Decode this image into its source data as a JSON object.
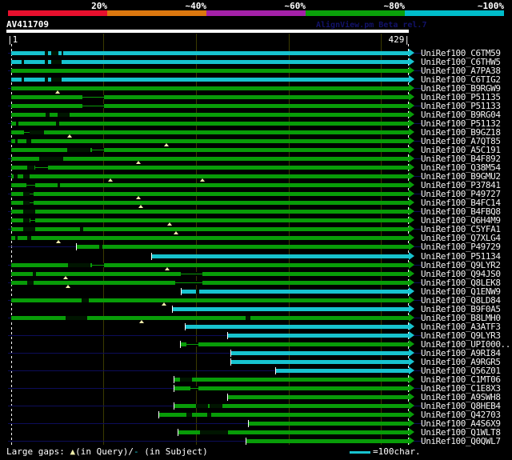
{
  "header": {
    "query_id": "AV411709",
    "credit": "AlignView.pm Beta rel.7"
  },
  "scale_bar": {
    "segments": [
      {
        "label": "20%",
        "color": "#e8102e"
      },
      {
        "label": "~40%",
        "color": "#dc780f"
      },
      {
        "label": "~60%",
        "color": "#a421a8"
      },
      {
        "label": "~80%",
        "color": "#0aa00a"
      },
      {
        "label": "~100%",
        "color": "#00bcca"
      }
    ]
  },
  "ruler": {
    "start_label": "|1",
    "end_label": "429|",
    "min": 1,
    "max": 429,
    "gridline_interval": 100
  },
  "legend": {
    "gaps_prefix": "Large gaps: ",
    "query_symbol": "▲",
    "query_text": "(in Query)/",
    "subject_symbol": "-",
    "subject_text": " (in Subject)",
    "scale_text": "=100char."
  },
  "colors": {
    "background": "#000000",
    "bar_green": "#089c08",
    "bar_cyan": "#17c3cf",
    "guide_navy": "#0d0d5a",
    "gridline_olive": "#3a3a00",
    "gap_dark": "#001500",
    "triangle_yellow": "#efedaa",
    "text_white": "#ffffff",
    "credit_navy": "#12126a"
  },
  "chart_data": {
    "type": "alignment-overview",
    "query": {
      "id": "AV411709",
      "length": 429
    },
    "x_range": [
      1,
      429
    ],
    "gridlines_at": [
      100,
      200,
      300,
      400
    ],
    "hits": [
      {
        "label": "UniRef100_C6TM59",
        "color": "cyan",
        "start": 1,
        "end": 429,
        "dashes": [
          [
            37,
            41
          ],
          [
            44,
            52
          ],
          [
            55,
            57
          ]
        ],
        "thins": [],
        "tris": [],
        "guide": true
      },
      {
        "label": "UniRef100_C6THW5",
        "color": "cyan",
        "start": 1,
        "end": 429,
        "dashes": [
          [
            12,
            15
          ],
          [
            37,
            41
          ],
          [
            44,
            55
          ]
        ],
        "thins": [],
        "tris": [],
        "guide": false
      },
      {
        "label": "UniRef100_A7PA38",
        "color": "green",
        "start": 1,
        "end": 429,
        "dashes": [],
        "thins": [],
        "tris": [],
        "guide": true
      },
      {
        "label": "UniRef100_C6TIG2",
        "color": "cyan",
        "start": 1,
        "end": 429,
        "dashes": [
          [
            12,
            15
          ],
          [
            37,
            41
          ],
          [
            44,
            55
          ]
        ],
        "thins": [],
        "tris": [],
        "guide": false
      },
      {
        "label": "UniRef100_B9RGW9",
        "color": "green",
        "start": 1,
        "end": 429,
        "dashes": [],
        "thins": [],
        "tris": [
          51
        ],
        "guide": true
      },
      {
        "label": "UniRef100_P51135",
        "color": "green",
        "start": 1,
        "end": 429,
        "dashes": [],
        "thins": [
          [
            78,
            101
          ]
        ],
        "tris": [],
        "guide": false
      },
      {
        "label": "UniRef100_P51133",
        "color": "green",
        "start": 1,
        "end": 429,
        "dashes": [],
        "thins": [
          [
            78,
            101
          ]
        ],
        "tris": [],
        "guide": true
      },
      {
        "label": "UniRef100_B9RG04",
        "color": "green",
        "start": 1,
        "end": 429,
        "dashes": [
          [
            38,
            42
          ],
          [
            51,
            64
          ]
        ],
        "thins": [],
        "tris": [],
        "guide": false
      },
      {
        "label": "UniRef100_P51132",
        "color": "green",
        "start": 1,
        "end": 429,
        "dashes": [
          [
            6,
            9
          ],
          [
            49,
            53
          ]
        ],
        "thins": [],
        "tris": [],
        "guide": true
      },
      {
        "label": "UniRef100_B9GZ18",
        "color": "green",
        "start": 1,
        "end": 429,
        "dashes": [
          [
            21,
            36
          ]
        ],
        "thins": [
          [
            15,
            21
          ]
        ],
        "tris": [
          64
        ],
        "guide": false
      },
      {
        "label": "UniRef100_A7QT85",
        "color": "green",
        "start": 1,
        "end": 429,
        "dashes": [
          [
            5,
            8
          ],
          [
            17,
            23
          ]
        ],
        "thins": [],
        "tris": [
          168
        ],
        "guide": true
      },
      {
        "label": "UniRef100_A5C191",
        "color": "green",
        "start": 1,
        "end": 429,
        "dashes": [
          [
            61,
            86
          ]
        ],
        "thins": [
          [
            88,
            101
          ]
        ],
        "tris": [],
        "guide": false
      },
      {
        "label": "UniRef100_B4F892",
        "color": "green",
        "start": 1,
        "end": 429,
        "dashes": [
          [
            31,
            57
          ]
        ],
        "thins": [],
        "tris": [
          138
        ],
        "guide": true
      },
      {
        "label": "UniRef100_Q38M54",
        "color": "green",
        "start": 1,
        "end": 429,
        "dashes": [
          [
            18,
            26
          ]
        ],
        "thins": [
          [
            27,
            41
          ]
        ],
        "tris": [],
        "guide": false
      },
      {
        "label": "UniRef100_B9GMU2",
        "color": "green",
        "start": 1,
        "end": 429,
        "dashes": [
          [
            4,
            8
          ],
          [
            14,
            21
          ]
        ],
        "thins": [],
        "tris": [
          108,
          207
        ],
        "guide": true
      },
      {
        "label": "UniRef100_P37841",
        "color": "green",
        "start": 1,
        "end": 429,
        "dashes": [
          [
            51,
            54
          ]
        ],
        "thins": [
          [
            17,
            27
          ]
        ],
        "tris": [],
        "guide": false
      },
      {
        "label": "UniRef100_P49727",
        "color": "green",
        "start": 1,
        "end": 429,
        "dashes": [
          [
            14,
            21
          ]
        ],
        "thins": [
          [
            21,
            25
          ]
        ],
        "tris": [
          138
        ],
        "guide": true
      },
      {
        "label": "UniRef100_B4FC14",
        "color": "green",
        "start": 1,
        "end": 429,
        "dashes": [
          [
            14,
            21
          ]
        ],
        "thins": [
          [
            21,
            25
          ]
        ],
        "tris": [
          141
        ],
        "guide": false
      },
      {
        "label": "UniRef100_B4FBQ8",
        "color": "green",
        "start": 1,
        "end": 429,
        "dashes": [
          [
            14,
            27
          ]
        ],
        "thins": [],
        "tris": [],
        "guide": true
      },
      {
        "label": "UniRef100_Q6H4M9",
        "color": "green",
        "start": 1,
        "end": 429,
        "dashes": [
          [
            14,
            21
          ]
        ],
        "thins": [
          [
            22,
            27
          ]
        ],
        "tris": [
          172
        ],
        "guide": false
      },
      {
        "label": "UniRef100_C5YFA1",
        "color": "green",
        "start": 1,
        "end": 429,
        "dashes": [
          [
            14,
            27
          ],
          [
            75,
            79
          ]
        ],
        "thins": [],
        "tris": [
          179
        ],
        "guide": true
      },
      {
        "label": "UniRef100_Q7XLG4",
        "color": "green",
        "start": 1,
        "end": 429,
        "dashes": [
          [
            5,
            8
          ],
          [
            18,
            23
          ]
        ],
        "thins": [],
        "tris": [
          52
        ],
        "guide": false
      },
      {
        "label": "UniRef100_P49729",
        "color": "green",
        "start": 72,
        "end": 429,
        "dashes": [
          [
            96,
            99
          ]
        ],
        "thins": [],
        "tris": [],
        "guide": true
      },
      {
        "label": "UniRef100_P51134",
        "color": "cyan",
        "start": 153,
        "end": 429,
        "dashes": [],
        "thins": [],
        "tris": [],
        "guide": false
      },
      {
        "label": "UniRef100_Q9LYR2",
        "color": "green",
        "start": 1,
        "end": 429,
        "dashes": [
          [
            62,
            86
          ]
        ],
        "thins": [
          [
            88,
            101
          ]
        ],
        "tris": [
          169
        ],
        "guide": true
      },
      {
        "label": "UniRef100_Q94JS0",
        "color": "green",
        "start": 1,
        "end": 429,
        "dashes": [
          [
            24,
            28
          ]
        ],
        "thins": [
          [
            184,
            207
          ]
        ],
        "tris": [
          60
        ],
        "guide": false
      },
      {
        "label": "UniRef100_Q8LEK8",
        "color": "green",
        "start": 1,
        "end": 429,
        "dashes": [
          [
            18,
            25
          ]
        ],
        "thins": [
          [
            178,
            207
          ]
        ],
        "tris": [
          62
        ],
        "guide": true
      },
      {
        "label": "UniRef100_Q1ENW9",
        "color": "cyan",
        "start": 185,
        "end": 429,
        "dashes": [
          [
            200,
            204
          ]
        ],
        "thins": [],
        "tris": [],
        "guide": false
      },
      {
        "label": "UniRef100_Q8LD84",
        "color": "green",
        "start": 1,
        "end": 429,
        "dashes": [
          [
            77,
            85
          ]
        ],
        "thins": [],
        "tris": [
          166
        ],
        "guide": true
      },
      {
        "label": "UniRef100_B9F0A5",
        "color": "cyan",
        "start": 175,
        "end": 429,
        "dashes": [],
        "thins": [],
        "tris": [],
        "guide": false
      },
      {
        "label": "UniRef100_B8LMH0",
        "color": "green",
        "start": 1,
        "end": 429,
        "dashes": [
          [
            60,
            83
          ],
          [
            254,
            259
          ]
        ],
        "thins": [],
        "tris": [
          142
        ],
        "guide": true
      },
      {
        "label": "UniRef100_A3ATF3",
        "color": "cyan",
        "start": 189,
        "end": 429,
        "dashes": [],
        "thins": [],
        "tris": [],
        "guide": false
      },
      {
        "label": "UniRef100_Q9LYR3",
        "color": "cyan",
        "start": 235,
        "end": 429,
        "dashes": [],
        "thins": [],
        "tris": [],
        "guide": true
      },
      {
        "label": "UniRef100_UPI000..",
        "color": "green",
        "start": 184,
        "end": 429,
        "dashes": [],
        "thins": [
          [
            190,
            203
          ]
        ],
        "tris": [],
        "guide": false
      },
      {
        "label": "UniRef100_A9RI84",
        "color": "cyan",
        "start": 238,
        "end": 429,
        "dashes": [],
        "thins": [],
        "tris": [],
        "guide": true
      },
      {
        "label": "UniRef100_A9RGR5",
        "color": "cyan",
        "start": 238,
        "end": 429,
        "dashes": [],
        "thins": [],
        "tris": [],
        "guide": false
      },
      {
        "label": "UniRef100_Q56Z01",
        "color": "cyan",
        "start": 287,
        "end": 429,
        "dashes": [],
        "thins": [],
        "tris": [],
        "guide": true
      },
      {
        "label": "UniRef100_C1MT06",
        "color": "green",
        "start": 177,
        "end": 429,
        "dashes": [
          [
            183,
            196
          ]
        ],
        "thins": [],
        "tris": [],
        "guide": false
      },
      {
        "label": "UniRef100_C1E8X3",
        "color": "green",
        "start": 177,
        "end": 429,
        "dashes": [],
        "thins": [
          [
            194,
            203
          ]
        ],
        "tris": [],
        "guide": true
      },
      {
        "label": "UniRef100_A9SWH8",
        "color": "green",
        "start": 235,
        "end": 429,
        "dashes": [],
        "thins": [],
        "tris": [],
        "guide": false
      },
      {
        "label": "UniRef100_Q8HEB4",
        "color": "green",
        "start": 177,
        "end": 429,
        "dashes": [
          [
            200,
            213
          ],
          [
            215,
            229
          ]
        ],
        "thins": [],
        "tris": [],
        "guide": true
      },
      {
        "label": "UniRef100_Q42703",
        "color": "green",
        "start": 161,
        "end": 429,
        "dashes": [
          [
            190,
            196
          ],
          [
            212,
            217
          ]
        ],
        "thins": [],
        "tris": [],
        "guide": false
      },
      {
        "label": "UniRef100_A4S6X9",
        "color": "green",
        "start": 257,
        "end": 429,
        "dashes": [],
        "thins": [],
        "tris": [],
        "guide": true
      },
      {
        "label": "UniRef100_Q1WLT8",
        "color": "green",
        "start": 181,
        "end": 429,
        "dashes": [
          [
            205,
            235
          ]
        ],
        "thins": [],
        "tris": [],
        "guide": false
      },
      {
        "label": "UniRef100_Q0QWL7",
        "color": "green",
        "start": 255,
        "end": 429,
        "dashes": [],
        "thins": [],
        "tris": [],
        "guide": true
      }
    ]
  }
}
